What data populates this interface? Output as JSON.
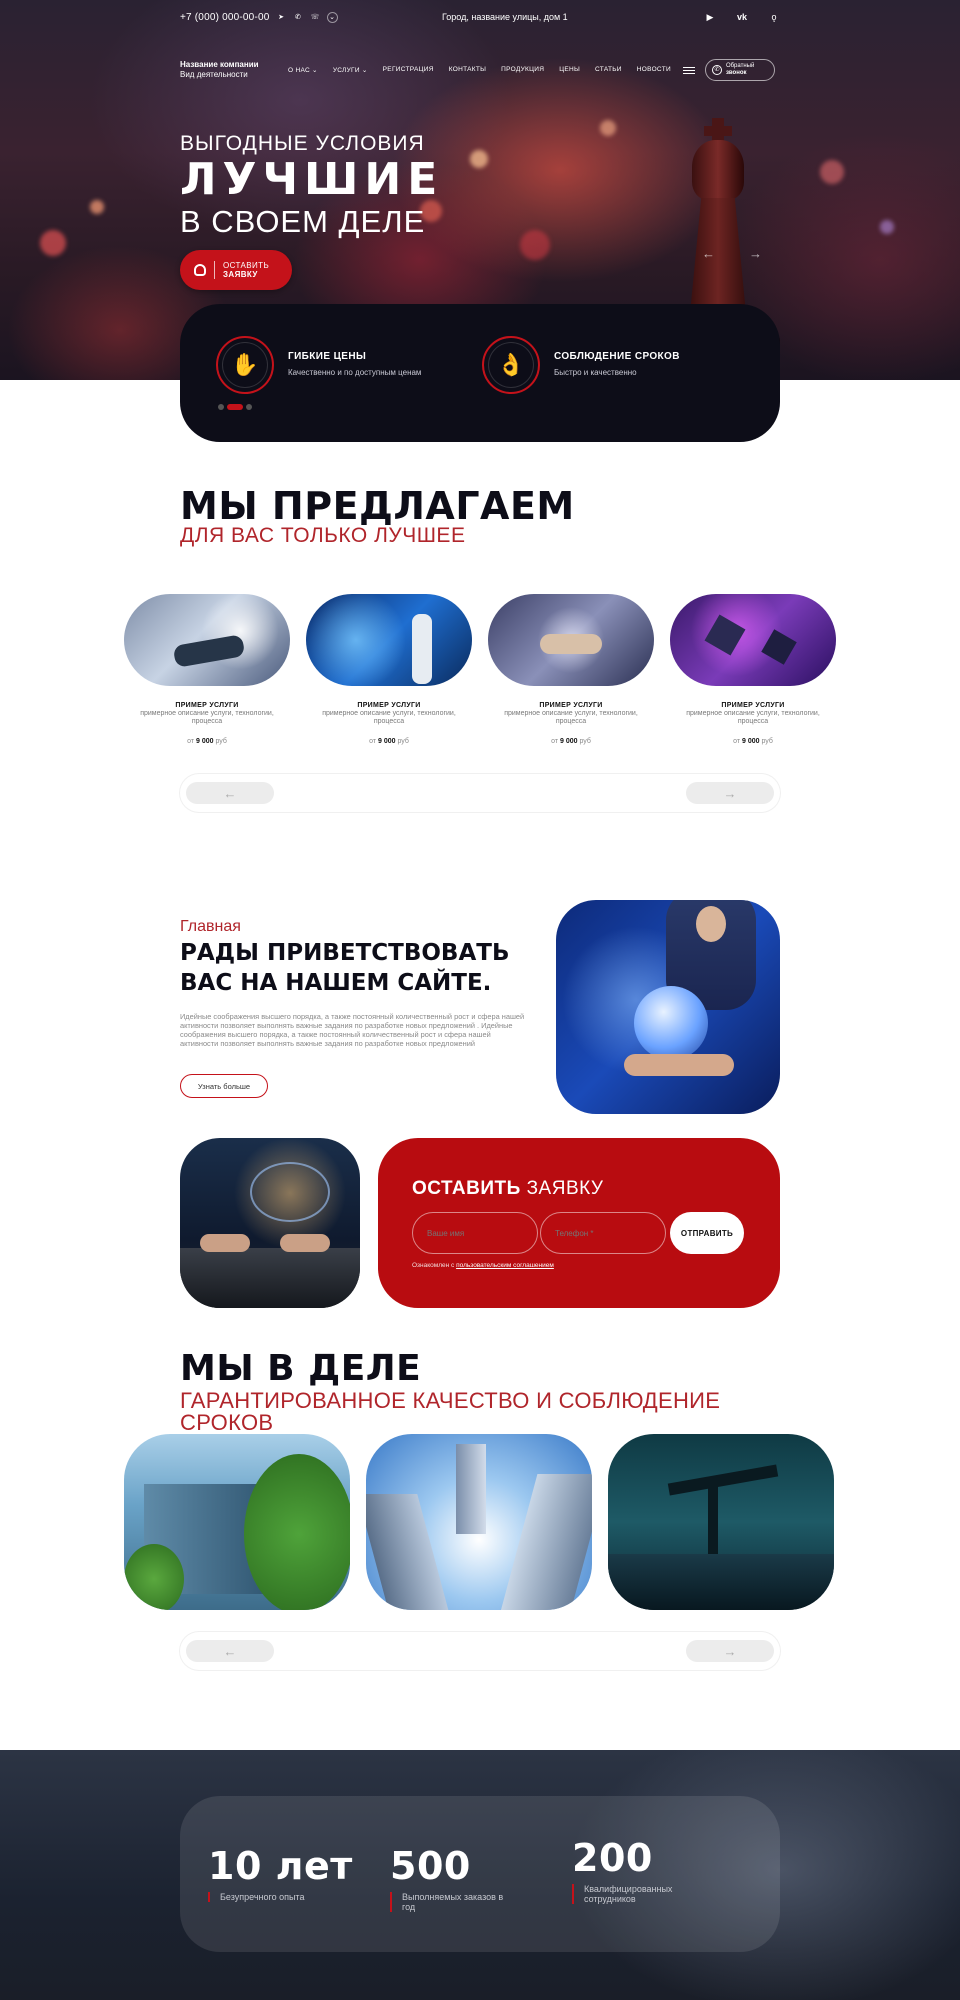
{
  "topbar": {
    "phone": "+7 (000) 000-00-00",
    "address": "Город, название улицы, дом 1"
  },
  "company": {
    "name": "Название компании",
    "activity": "Вид деятельности"
  },
  "menu": [
    "О НАС",
    "УСЛУГИ",
    "РЕГИСТРАЦИЯ",
    "КОНТАКТЫ",
    "ПРОДУКЦИЯ",
    "ЦЕНЫ",
    "СТАТЬИ",
    "НОВОСТИ"
  ],
  "callback": {
    "line1": "Обратный",
    "line2": "звонок"
  },
  "hero": {
    "line1": "ВЫГОДНЫЕ УСЛОВИЯ",
    "line2": "ЛУЧШИЕ",
    "line3": "В СВОЕМ ДЕЛЕ",
    "button_line1": "ОСТАВИТЬ",
    "button_line2": "ЗАЯВКУ"
  },
  "features": [
    {
      "title": "ГИБКИЕ ЦЕНЫ",
      "text": "Качественно и по доступным ценам",
      "icon": "hand-coin-icon"
    },
    {
      "title": "СОБЛЮДЕНИЕ СРОКОВ",
      "text": "Быстро и качественно",
      "icon": "hand-ok-icon"
    }
  ],
  "offer": {
    "title": "МЫ ПРЕДЛАГАЕМ",
    "subtitle": "ДЛЯ ВАС ТОЛЬКО ЛУЧШЕЕ",
    "services": [
      {
        "name": "ПРИМЕР УСЛУГИ",
        "desc": "примерное описание услуги, технологии, процесса",
        "price_prefix": "от",
        "price": "9 000",
        "currency": "руб"
      },
      {
        "name": "ПРИМЕР УСЛУГИ",
        "desc": "примерное описание услуги, технологии, процесса",
        "price_prefix": "от",
        "price": "9 000",
        "currency": "руб"
      },
      {
        "name": "ПРИМЕР УСЛУГИ",
        "desc": "примерное описание услуги, технологии, процесса",
        "price_prefix": "от",
        "price": "9 000",
        "currency": "руб"
      },
      {
        "name": "ПРИМЕР УСЛУГИ",
        "desc": "примерное описание услуги, технологии, процесса",
        "price_prefix": "от",
        "price": "9 000",
        "currency": "руб"
      }
    ]
  },
  "welcome": {
    "crumb": "Главная",
    "title": "РАДЫ ПРИВЕТСТВОВАТЬ ВАС НА НАШЕМ САЙТЕ.",
    "text": "Идейные соображения высшего порядка, а также постоянный количественный рост и сфера нашей активности позволяет выполнять важные задания по разработке новых предложений . Идейные соображения высшего порядка, а также постоянный количественный рост и сфера нашей активности позволяет выполнять важные задания по разработке новых предложений",
    "more": "Узнать больше"
  },
  "form": {
    "title_bold": "ОСТАВИТЬ",
    "title_rest": "ЗАЯВКУ",
    "name_placeholder": "Ваше имя",
    "phone_placeholder": "Телефон *",
    "submit": "ОТПРАВИТЬ",
    "agree_prefix": "Ознакомлен с",
    "agree_link": "пользовательским соглашением"
  },
  "work": {
    "title": "МЫ В ДЕЛЕ",
    "subtitle": "ГАРАНТИРОВАННОЕ КАЧЕСТВО И СОБЛЮДЕНИЕ СРОКОВ"
  },
  "stats": [
    {
      "num": "10 лет",
      "label": "Безупречного опыта"
    },
    {
      "num": "500",
      "label": "Выполняемых заказов в год"
    },
    {
      "num": "200",
      "label": "Квалифицированных сотрудников"
    }
  ],
  "colors": {
    "accent": "#c4121a",
    "dark": "#0d0d18",
    "subtitle_red": "#b0252b"
  }
}
